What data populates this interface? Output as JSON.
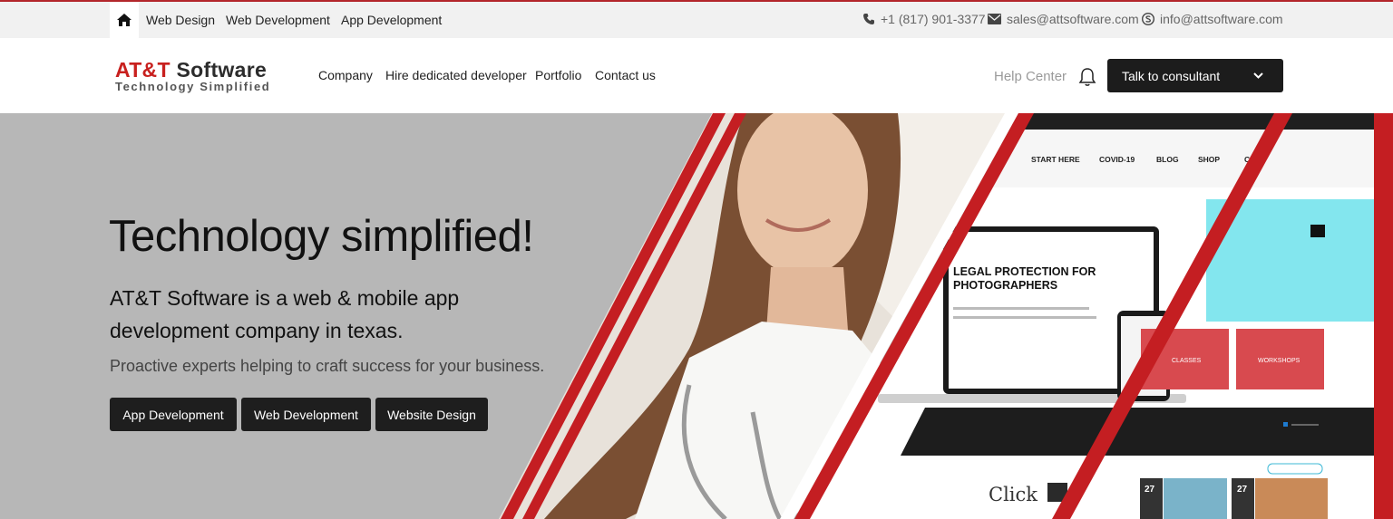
{
  "colors": {
    "brand_red": "#c8201e",
    "dark": "#1c1c1c",
    "topbar_bg": "#f1f1f1",
    "hero_bg": "#b7b7b7"
  },
  "topbar": {
    "home_icon": "home-icon",
    "links": [
      "Web Design",
      "Web Development",
      "App Development"
    ],
    "phone": "+1 (817) 901-3377",
    "email": "sales@attsoftware.com",
    "skype": "info@attsoftware.com"
  },
  "logo": {
    "brand_part1": "AT&T",
    "brand_part2": "Software",
    "tagline": "Technology Simplified"
  },
  "nav": {
    "items": [
      "Company",
      "Hire dedicated developer",
      "Portfolio",
      "Contact us"
    ]
  },
  "header_actions": {
    "help": "Help Center",
    "bell_icon": "bell-icon",
    "consult": "Talk to consultant",
    "chevron_icon": "chevron-down-icon"
  },
  "hero": {
    "title": "Technology simplified!",
    "subtitle": "AT&T Software is a web & mobile app development company in texas.",
    "description": "Proactive experts helping to craft success for your business.",
    "buttons": [
      "App Development",
      "Web Development",
      "Website Design"
    ]
  },
  "mockup": {
    "menu": [
      "START HERE",
      "COVID-19",
      "BLOG",
      "SHOP",
      "CO"
    ],
    "headline_line1": "LEGAL PROTECTION FOR",
    "headline_line2": "PHOTOGRAPHERS",
    "card1": "CLASSES",
    "card2": "WORKSHOPS",
    "script": "Click",
    "day1": "27",
    "day2": "27"
  }
}
